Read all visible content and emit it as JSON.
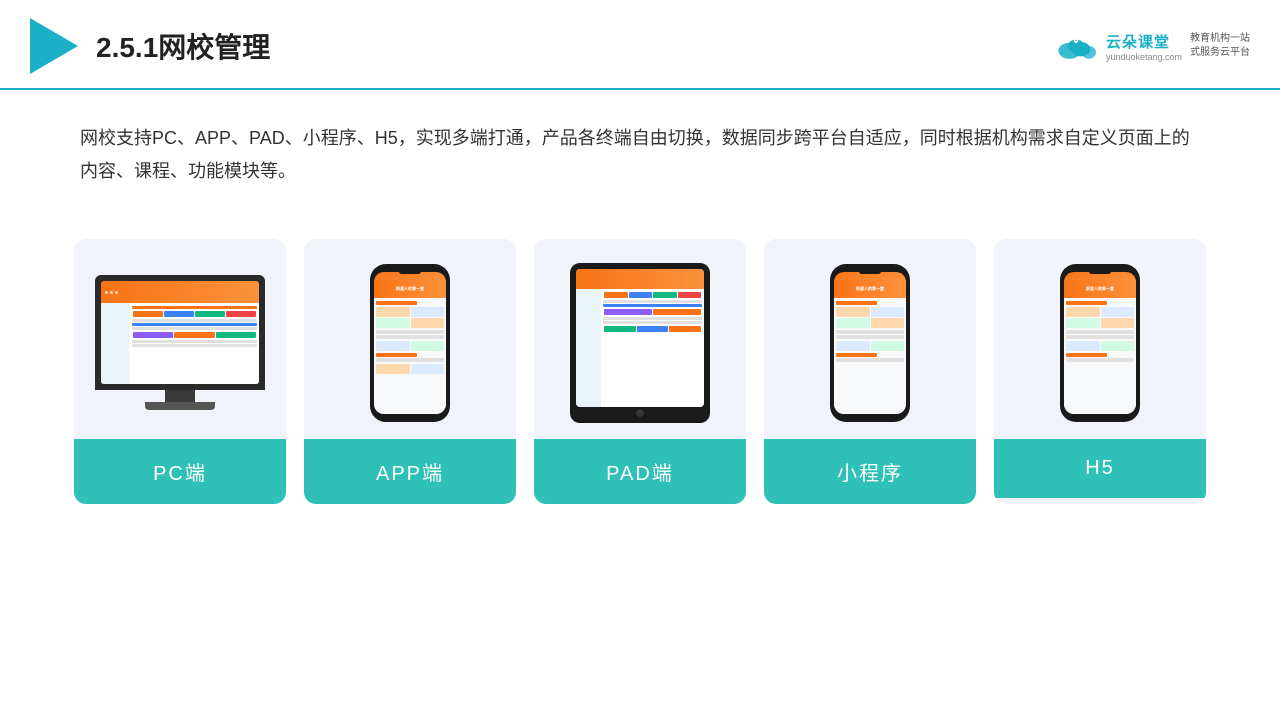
{
  "header": {
    "title": "2.5.1网校管理",
    "brand": {
      "name": "云朵课堂",
      "url": "yunduoketang.com",
      "tagline": "教育机构一站\n式服务云平台"
    }
  },
  "description": "网校支持PC、APP、PAD、小程序、H5，实现多端打通，产品各终端自由切换，数据同步跨平台自适应，同时根据机构需求自定义页面上的内容、课程、功能模块等。",
  "cards": [
    {
      "id": "pc",
      "label": "PC端"
    },
    {
      "id": "app",
      "label": "APP端"
    },
    {
      "id": "pad",
      "label": "PAD端"
    },
    {
      "id": "miniprogram",
      "label": "小程序"
    },
    {
      "id": "h5",
      "label": "H5"
    }
  ],
  "accent_color": "#2fc1b8"
}
